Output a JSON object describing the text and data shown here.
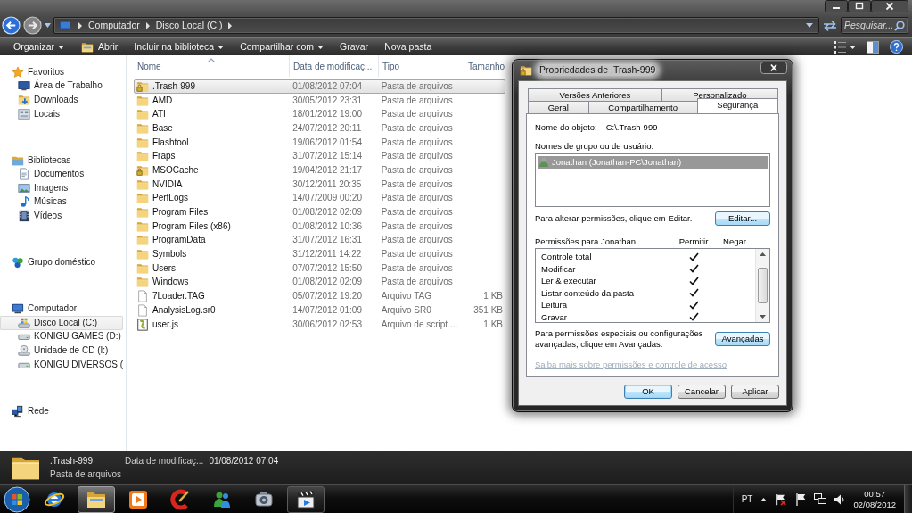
{
  "address_bar": {
    "crumbs": [
      "Computador",
      "Disco Local (C:)"
    ]
  },
  "search": {
    "placeholder": "Pesquisar..."
  },
  "toolbar": [
    {
      "label": "Organizar",
      "kind": "menu"
    },
    {
      "label": "Abrir",
      "kind": "open"
    },
    {
      "label": "Incluir na biblioteca",
      "kind": "menu"
    },
    {
      "label": "Compartilhar com",
      "kind": "menu"
    },
    {
      "label": "Gravar",
      "kind": "plain"
    },
    {
      "label": "Nova pasta",
      "kind": "plain"
    }
  ],
  "sidebar": [
    {
      "label": "Favoritos",
      "kind": "favorites",
      "selected": false,
      "children": [
        {
          "label": "Área de Trabalho",
          "kind": "desktop",
          "selected": false
        },
        {
          "label": "Downloads",
          "kind": "downloads",
          "selected": false
        },
        {
          "label": "Locais",
          "kind": "places",
          "selected": false
        }
      ]
    },
    {
      "label": "Bibliotecas",
      "kind": "libraries",
      "selected": false,
      "children": [
        {
          "label": "Documentos",
          "kind": "documents",
          "selected": false
        },
        {
          "label": "Imagens",
          "kind": "pictures",
          "selected": false
        },
        {
          "label": "Músicas",
          "kind": "music",
          "selected": false
        },
        {
          "label": "Vídeos",
          "kind": "videos",
          "selected": false
        }
      ]
    },
    {
      "label": "Grupo doméstico",
      "kind": "homegroup",
      "selected": false
    },
    {
      "label": "Computador",
      "kind": "computer",
      "selected": false,
      "children": [
        {
          "label": "Disco Local (C:)",
          "kind": "system-drive",
          "selected": true
        },
        {
          "label": "KONIGU GAMES (D:)",
          "kind": "drive",
          "selected": false
        },
        {
          "label": "Unidade de CD (I:)",
          "kind": "cd",
          "selected": false
        },
        {
          "label": "KONIGU DIVERSOS (",
          "kind": "drive",
          "selected": false
        }
      ]
    },
    {
      "label": "Rede",
      "kind": "network",
      "selected": false
    }
  ],
  "file_list": {
    "columns": [
      {
        "label": "Nome",
        "sorted": true
      },
      {
        "label": "Data de modificaç...",
        "sorted": false
      },
      {
        "label": "Tipo",
        "sorted": false
      },
      {
        "label": "Tamanho",
        "sorted": false
      }
    ],
    "rows": [
      {
        "kind": "locked-folder",
        "name": ".Trash-999",
        "date": "01/08/2012 07:04",
        "type": "Pasta de arquivos",
        "selected": true
      },
      {
        "kind": "folder",
        "name": "AMD",
        "date": "30/05/2012 23:31",
        "type": "Pasta de arquivos",
        "selected": false
      },
      {
        "kind": "folder",
        "name": "ATI",
        "date": "18/01/2012 19:00",
        "type": "Pasta de arquivos",
        "selected": false
      },
      {
        "kind": "folder",
        "name": "Base",
        "date": "24/07/2012 20:11",
        "type": "Pasta de arquivos",
        "selected": false
      },
      {
        "kind": "folder",
        "name": "Flashtool",
        "date": "19/06/2012 01:54",
        "type": "Pasta de arquivos",
        "selected": false
      },
      {
        "kind": "folder",
        "name": "Fraps",
        "date": "31/07/2012 15:14",
        "type": "Pasta de arquivos",
        "selected": false
      },
      {
        "kind": "locked-folder",
        "name": "MSOCache",
        "date": "19/04/2012 21:17",
        "type": "Pasta de arquivos",
        "selected": false
      },
      {
        "kind": "folder",
        "name": "NVIDIA",
        "date": "30/12/2011 20:35",
        "type": "Pasta de arquivos",
        "selected": false
      },
      {
        "kind": "folder",
        "name": "PerfLogs",
        "date": "14/07/2009 00:20",
        "type": "Pasta de arquivos",
        "selected": false
      },
      {
        "kind": "folder",
        "name": "Program Files",
        "date": "01/08/2012 02:09",
        "type": "Pasta de arquivos",
        "selected": false
      },
      {
        "kind": "folder",
        "name": "Program Files (x86)",
        "date": "01/08/2012 10:36",
        "type": "Pasta de arquivos",
        "selected": false
      },
      {
        "kind": "folder",
        "name": "ProgramData",
        "date": "31/07/2012 16:31",
        "type": "Pasta de arquivos",
        "selected": false
      },
      {
        "kind": "folder",
        "name": "Symbols",
        "date": "31/12/2011 14:22",
        "type": "Pasta de arquivos",
        "selected": false
      },
      {
        "kind": "folder",
        "name": "Users",
        "date": "07/07/2012 15:50",
        "type": "Pasta de arquivos",
        "selected": false
      },
      {
        "kind": "folder",
        "name": "Windows",
        "date": "01/08/2012 02:09",
        "type": "Pasta de arquivos",
        "selected": false
      },
      {
        "kind": "file",
        "name": "7Loader.TAG",
        "date": "05/07/2012 19:20",
        "type": "Arquivo TAG",
        "size": "1 KB",
        "selected": false
      },
      {
        "kind": "file",
        "name": "AnalysisLog.sr0",
        "date": "14/07/2012 01:09",
        "type": "Arquivo SR0",
        "size": "351 KB",
        "selected": false
      },
      {
        "kind": "script",
        "name": "user.js",
        "date": "30/06/2012 02:53",
        "type": "Arquivo de script ...",
        "size": "1 KB",
        "selected": false
      }
    ]
  },
  "details": {
    "kind": "folder",
    "name": ".Trash-999",
    "type": "Pasta de arquivos",
    "field": "Data de modificaç...",
    "value": "01/08/2012 07:04"
  },
  "dialog": {
    "title": "Propriedades de .Trash-999",
    "tab_rows": [
      [
        {
          "label": "Versões Anteriores",
          "selected": false
        },
        {
          "label": "Personalizado",
          "selected": false
        }
      ],
      [
        {
          "label": "Geral",
          "selected": false
        },
        {
          "label": "Compartilhamento",
          "selected": false
        },
        {
          "label": "Segurança",
          "selected": true
        }
      ]
    ],
    "object_label": "Nome do objeto:",
    "object_value": "C:\\.Trash-999",
    "groups_label": "Nomes de grupo ou de usuário:",
    "users": [
      {
        "name": "Jonathan (Jonathan-PC\\Jonathan)",
        "selected": true
      }
    ],
    "edit_hint": "Para alterar permissões, clique em Editar.",
    "edit_button": "Editar...",
    "permissions_label": "Permissões para Jonathan",
    "allow_label": "Permitir",
    "deny_label": "Negar",
    "permissions": [
      {
        "name": "Controle total",
        "allow": true,
        "deny": false
      },
      {
        "name": "Modificar",
        "allow": true,
        "deny": false
      },
      {
        "name": "Ler & executar",
        "allow": true,
        "deny": false
      },
      {
        "name": "Listar conteúdo da pasta",
        "allow": true,
        "deny": false
      },
      {
        "name": "Leitura",
        "allow": true,
        "deny": false
      },
      {
        "name": "Gravar",
        "allow": true,
        "deny": false
      }
    ],
    "advanced_hint": "Para permissões especiais ou configurações avançadas, clique em Avançadas.",
    "advanced_button": "Avançadas",
    "help_link": {
      "label": "Saiba mais sobre permissões e controle de acesso",
      "disabled": true
    },
    "buttons": [
      {
        "label": "OK",
        "default": true
      },
      {
        "label": "Cancelar",
        "default": false
      },
      {
        "label": "Aplicar",
        "default": false
      }
    ]
  },
  "taskbar": {
    "apps": [
      {
        "kind": "browser",
        "running": false,
        "focused": false
      },
      {
        "kind": "explorer",
        "running": true,
        "focused": true
      },
      {
        "kind": "media",
        "running": false,
        "focused": false
      },
      {
        "kind": "cleaner",
        "running": false,
        "focused": false
      },
      {
        "kind": "messenger",
        "running": false,
        "focused": false
      },
      {
        "kind": "camera",
        "running": false,
        "focused": false
      },
      {
        "kind": "video",
        "running": true,
        "focused": false
      }
    ],
    "language": "PT",
    "time": "00:57",
    "date": "02/08/2012"
  }
}
